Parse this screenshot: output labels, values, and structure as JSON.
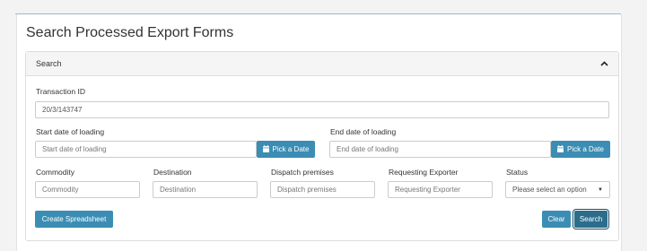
{
  "page": {
    "title": "Search Processed Export Forms"
  },
  "panel": {
    "label": "Search"
  },
  "transaction": {
    "label": "Transaction ID",
    "value": "20/3/143747"
  },
  "start_date": {
    "label": "Start date of loading",
    "placeholder": "Start date of loading",
    "button_label": "Pick a Date"
  },
  "end_date": {
    "label": "End date of loading",
    "placeholder": "End date of loading",
    "button_label": "Pick a Date"
  },
  "commodity": {
    "label": "Commodity",
    "placeholder": "Commodity"
  },
  "destination": {
    "label": "Destination",
    "placeholder": "Destination"
  },
  "dispatch": {
    "label": "Dispatch premises",
    "placeholder": "Dispatch premises"
  },
  "exporter": {
    "label": "Requesting Exporter",
    "placeholder": "Requesting Exporter"
  },
  "status": {
    "label": "Status",
    "selected": "Please select an option"
  },
  "buttons": {
    "create": "Create Spreadsheet",
    "clear": "Clear",
    "search": "Search"
  },
  "colors": {
    "primary": "#3b8db4",
    "active": "#2c6d8c"
  },
  "icons": {
    "collapse": "chevron-up-icon",
    "calendar": "calendar-icon",
    "status_caret": "caret-down-icon"
  }
}
